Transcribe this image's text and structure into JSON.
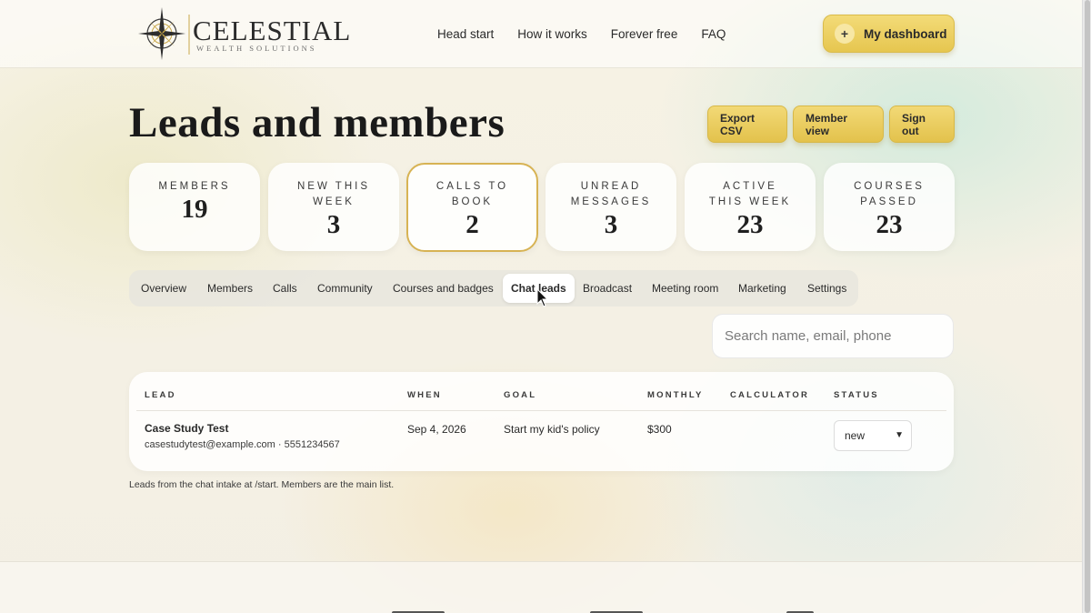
{
  "header": {
    "logo_title": "CELESTIAL",
    "logo_sub": "WEALTH SOLUTIONS",
    "nav": [
      "Head start",
      "How it works",
      "Forever free",
      "FAQ"
    ],
    "dashboard_button": "My dashboard",
    "dashboard_plus": "+"
  },
  "page": {
    "title": "Leads and members",
    "actions": [
      "Export CSV",
      "Member view",
      "Sign out"
    ]
  },
  "stats": [
    {
      "label": "Members",
      "value": "19"
    },
    {
      "label": "New this week",
      "value": "3"
    },
    {
      "label": "Calls to book",
      "value": "2"
    },
    {
      "label": "Unread messages",
      "value": "3"
    },
    {
      "label": "Active this week",
      "value": "23"
    },
    {
      "label": "Courses passed",
      "value": "23"
    }
  ],
  "tabs": [
    "Overview",
    "Members",
    "Calls",
    "Community",
    "Courses and badges",
    "Chat leads",
    "Broadcast",
    "Meeting room",
    "Marketing",
    "Settings"
  ],
  "selected_tab": "Chat leads",
  "search": {
    "placeholder": "Search name, email, phone"
  },
  "table": {
    "headers": [
      "LEAD",
      "WHEN",
      "GOAL",
      "MONTHLY",
      "CALCULATOR",
      "STATUS"
    ],
    "rows": [
      {
        "name": "Case Study Test",
        "contact": "casestudytest@example.com · 5551234567",
        "when": "Sep 4, 2026",
        "goal": "Start my kid's policy",
        "monthly": "$300",
        "calculator": "",
        "status": "new"
      }
    ]
  },
  "footnote": "Leads from the chat intake at /start. Members are the main list.",
  "colors": {
    "gold": "#e6c64f",
    "gold_border": "#d7b354",
    "text": "#1e1e1e"
  }
}
